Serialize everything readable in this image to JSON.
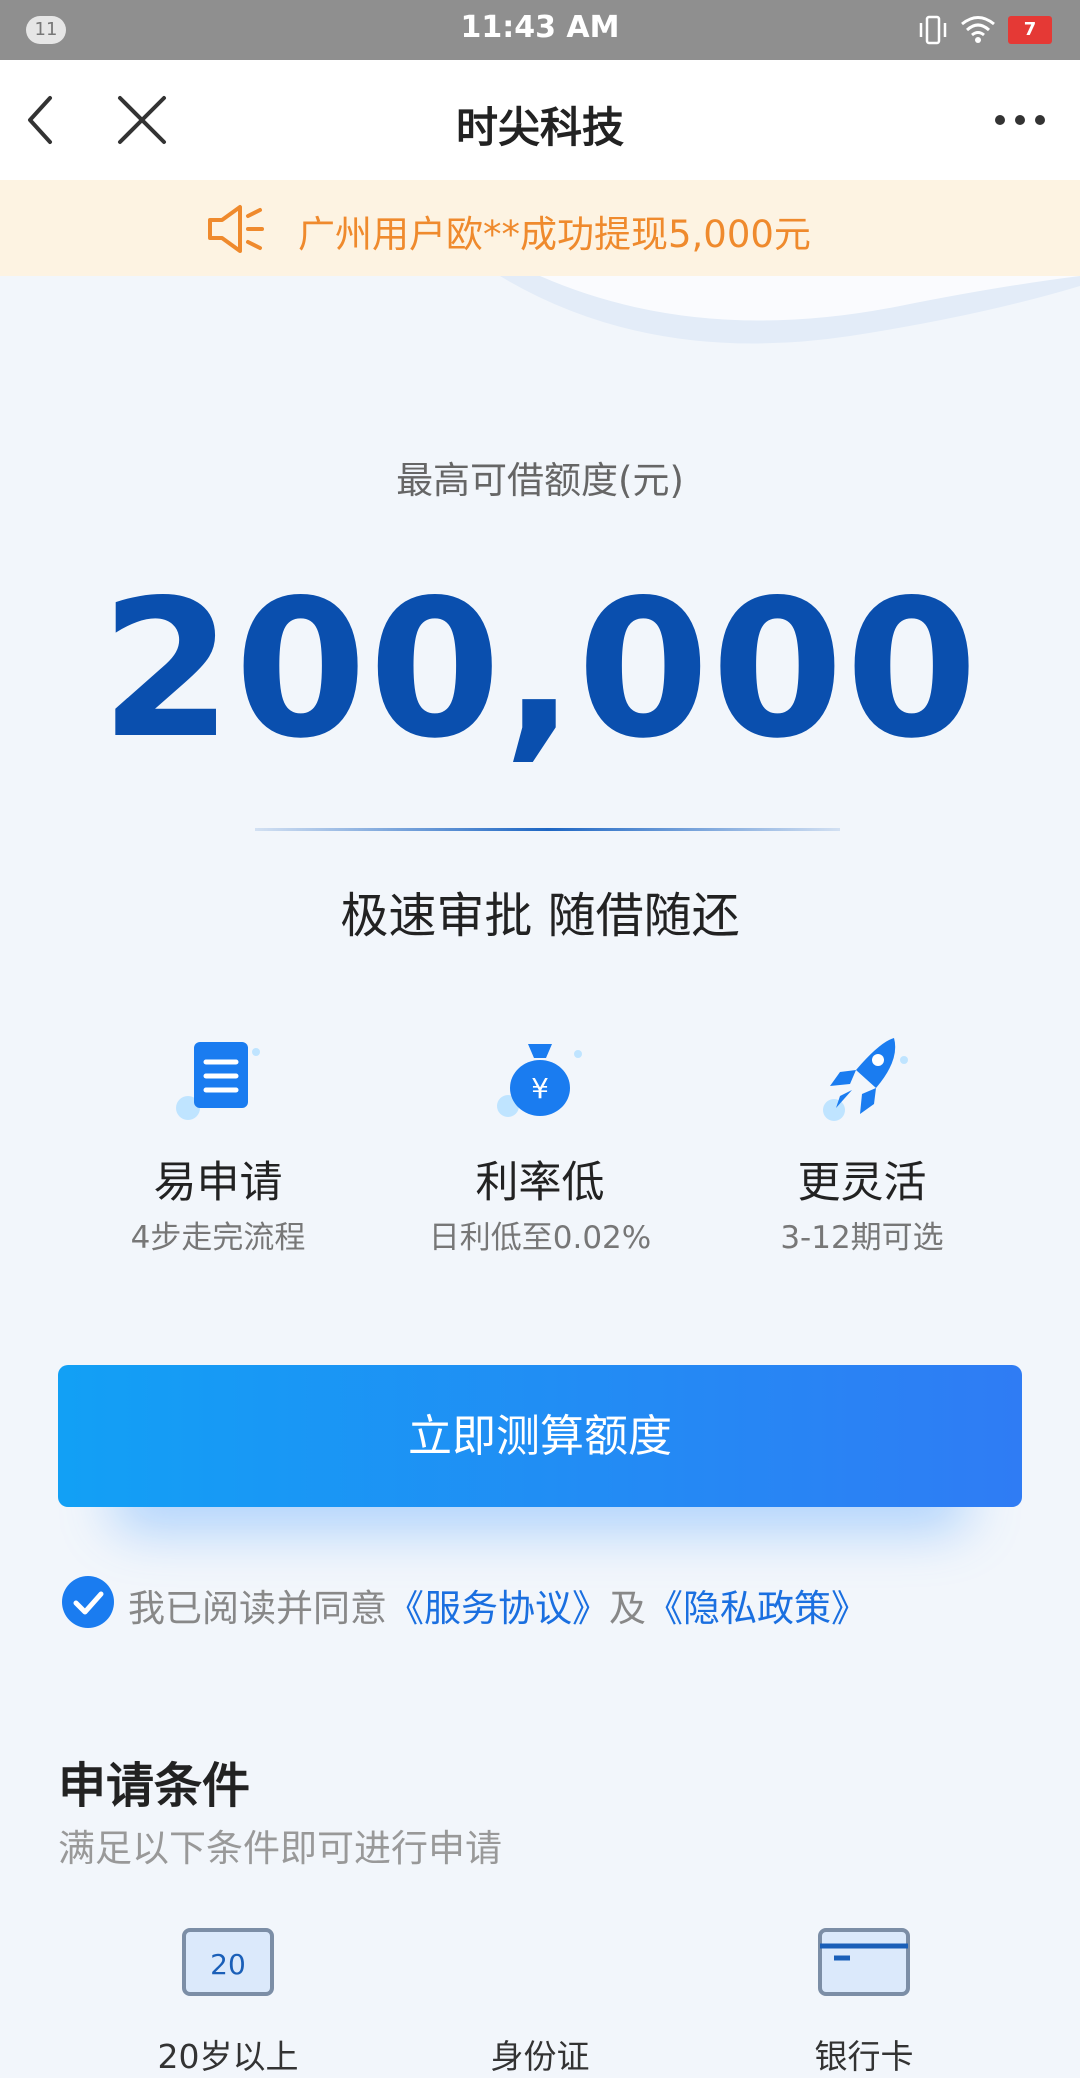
{
  "status_bar": {
    "notification_count": "11",
    "time": "11:43 AM",
    "battery": "7"
  },
  "nav": {
    "title": "时尖科技"
  },
  "notice": {
    "text": "广州用户欧**成功提现5,000元"
  },
  "hero": {
    "limit_label": "最高可借额度(元)",
    "limit_amount": "200,000",
    "slogan": "极速审批 随借随还"
  },
  "features": [
    {
      "icon": "document-icon",
      "title": "易申请",
      "desc": "4步走完流程"
    },
    {
      "icon": "money-bag-icon",
      "title": "利率低",
      "desc": "日利低至0.02%"
    },
    {
      "icon": "rocket-icon",
      "title": "更灵活",
      "desc": "3-12期可选"
    }
  ],
  "cta": {
    "label": "立即测算额度"
  },
  "agreement": {
    "prefix": "我已阅读并同意",
    "service_link": "《服务协议》",
    "middle": "及",
    "privacy_link": "《隐私政策》",
    "checked": true
  },
  "conditions": {
    "title": "申请条件",
    "subtitle": "满足以下条件即可进行申请",
    "items": [
      {
        "icon": "calendar-age-icon",
        "icon_text": "20",
        "label": "20岁以上"
      },
      {
        "icon": "id-card-icon",
        "label": "身份证"
      },
      {
        "icon": "bank-card-icon",
        "label": "银行卡"
      }
    ]
  },
  "colors": {
    "primary": "#0a4fae",
    "accent": "#1a7cf0",
    "notice_text": "#ef8a2d",
    "notice_bg": "#fdf3e2"
  }
}
